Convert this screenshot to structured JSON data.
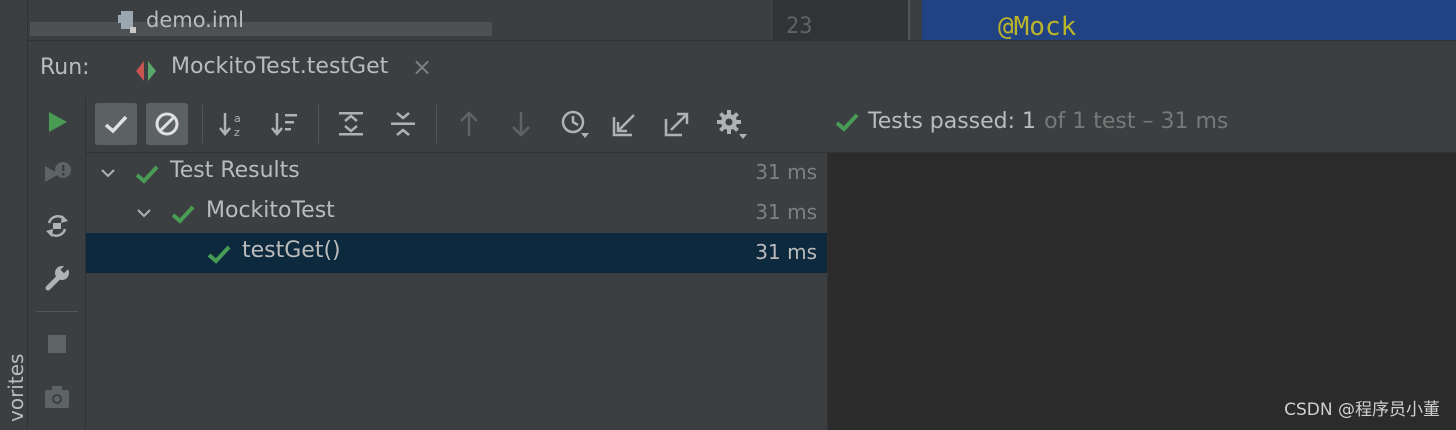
{
  "sidebar": {
    "favorites_label": "vorites"
  },
  "project": {
    "file_name": "demo.iml"
  },
  "editor": {
    "line_number": "23",
    "code_text": "@Mock"
  },
  "run": {
    "label": "Run:",
    "tab_label": "MockitoTest.testGet",
    "close_glyph": "×"
  },
  "status": {
    "prefix": "Tests passed: 1",
    "suffix": "of 1 test – 31 ms"
  },
  "tree": {
    "rows": [
      {
        "label": "Test Results",
        "time": "31 ms"
      },
      {
        "label": "MockitoTest",
        "time": "31 ms"
      },
      {
        "label": "testGet()",
        "time": "31 ms"
      }
    ]
  },
  "watermark": "CSDN @程序员小董",
  "colors": {
    "accent_green": "#499c54",
    "selection": "#0d293e",
    "panel": "#3c3f41",
    "console_bg": "#2b2b2b",
    "editor_highlight": "#214283"
  },
  "icons": {
    "toolbar": [
      "show-passed-icon",
      "show-ignored-icon",
      "sort-alpha-icon",
      "sort-duration-icon",
      "expand-all-icon",
      "collapse-all-icon",
      "prev-failed-icon",
      "next-failed-icon",
      "history-icon",
      "import-tests-icon",
      "export-tests-icon",
      "settings-icon"
    ],
    "side": [
      "rerun-icon",
      "rerun-failed-icon",
      "toggle-auto-test-icon",
      "wrench-icon",
      "stop-icon",
      "screenshot-icon"
    ]
  }
}
